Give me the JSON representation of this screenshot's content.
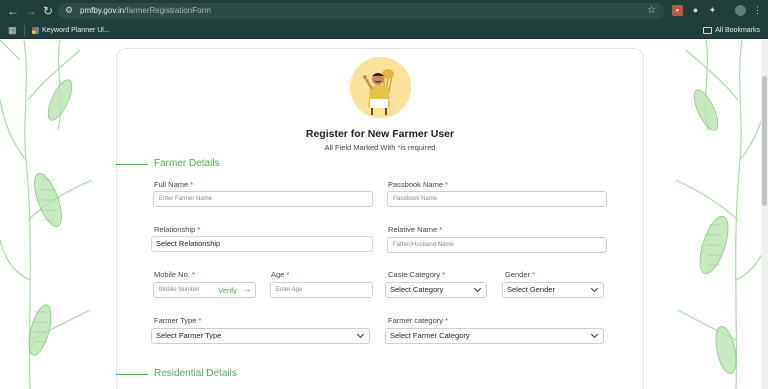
{
  "browser": {
    "url_host": "pmfby.gov.in",
    "url_path": "/farmerRegistrationForm",
    "bookmark_keyword": "Keyword Planner Ul...",
    "all_bookmarks": "All Bookmarks"
  },
  "header": {
    "title": "Register for New Farmer User",
    "subtitle_prefix": "All Field Marked With ",
    "subtitle_star": "*",
    "subtitle_suffix": "is required"
  },
  "sections": {
    "farmer_details": "Farmer Details",
    "residential_details": "Residential Details"
  },
  "fields": {
    "full_name": {
      "label": "Full Name ",
      "placeholder": "Enter Farmer Name"
    },
    "passbook_name": {
      "label": "Passbook Name ",
      "placeholder": "Passbook Name"
    },
    "relationship": {
      "label": "Relationship ",
      "value": "Select Relationship"
    },
    "relative_name": {
      "label": "Relative Name ",
      "placeholder": "Father/Husband Name"
    },
    "mobile": {
      "label": "Mobile No. ",
      "placeholder": "Mobile Number",
      "verify": "Verify"
    },
    "age": {
      "label": "Age ",
      "placeholder": "Enter Age"
    },
    "caste_category": {
      "label": "Caste Category ",
      "value": "Select Category"
    },
    "gender": {
      "label": "Gender ",
      "value": "Select Gender"
    },
    "farmer_type": {
      "label": "Farmer Type ",
      "value": "Select Farmer Type"
    },
    "farmer_category": {
      "label": "Farmer category ",
      "value": "Select Farmer Category"
    }
  },
  "required_mark": "*",
  "colors": {
    "accent": "#4caf50",
    "required": "#e53935",
    "chrome": "#1f3f3a"
  }
}
